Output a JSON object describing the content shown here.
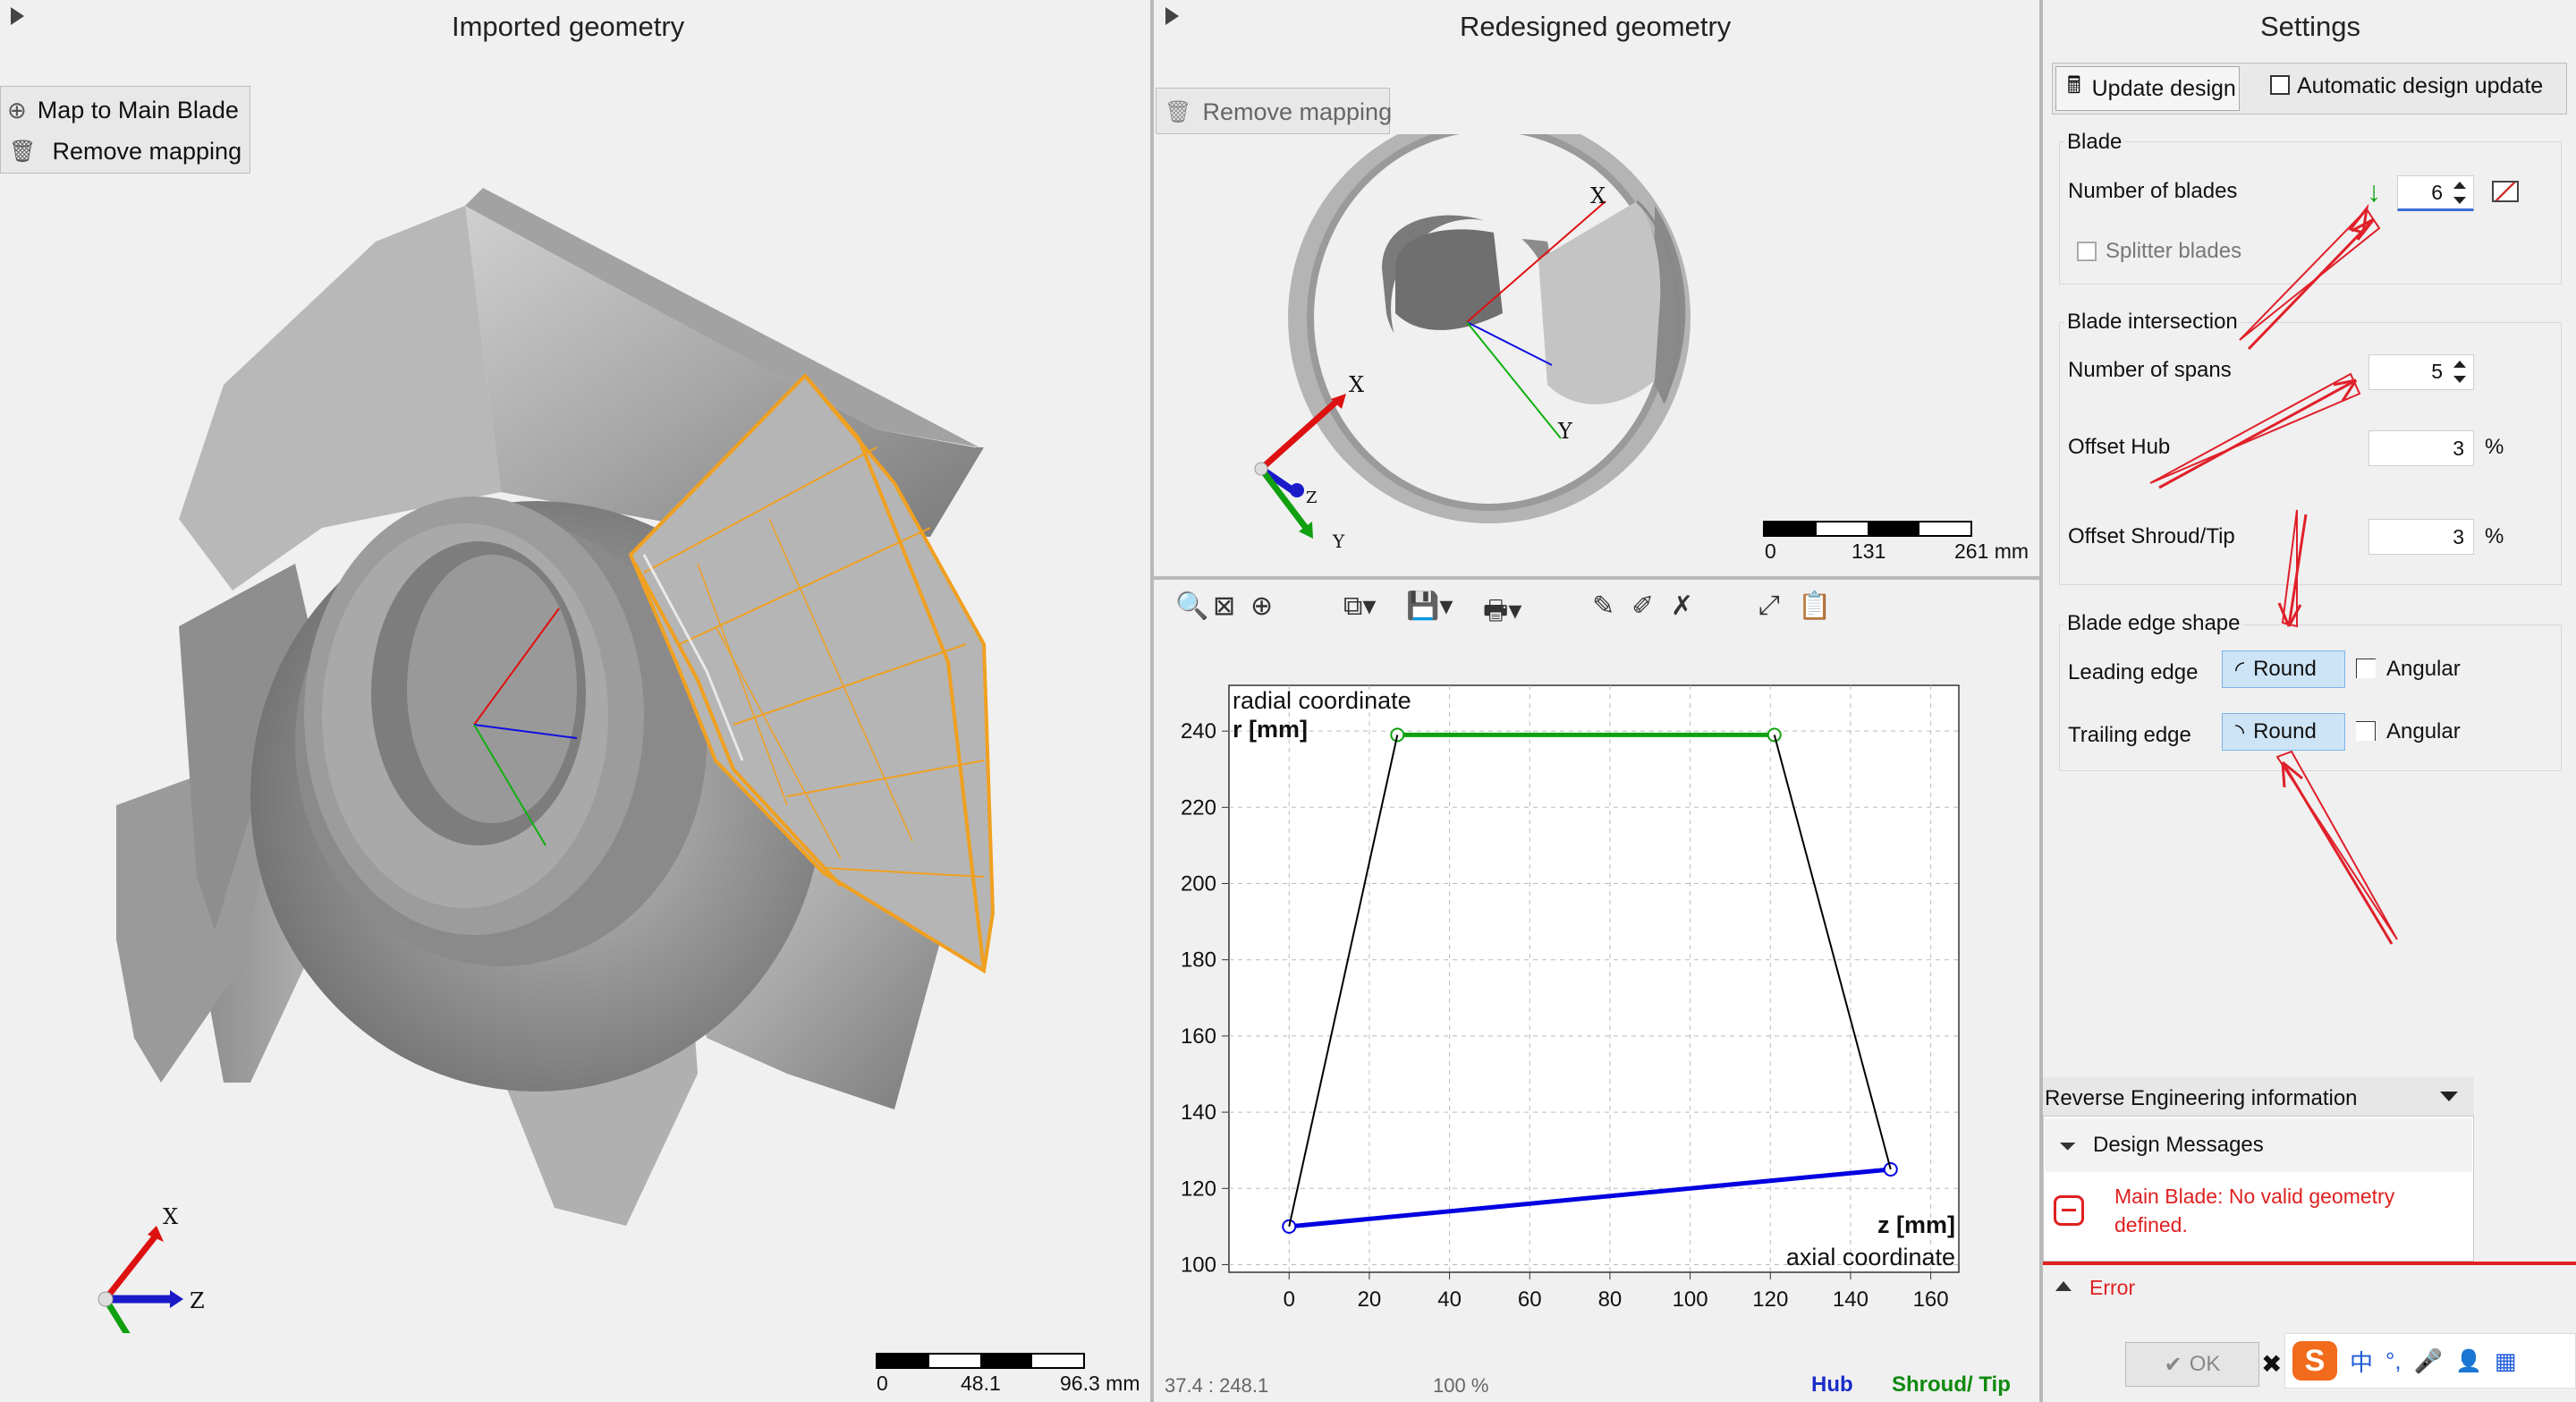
{
  "left_panel": {
    "title": "Imported geometry",
    "buttons": [
      {
        "label": "Map to Main Blade",
        "icon": "crosshair-icon"
      },
      {
        "label": "Remove mapping",
        "icon": "trash-icon"
      }
    ],
    "axes": {
      "x": "X",
      "y": "Y",
      "z": "Z"
    },
    "scale": {
      "ticks": [
        "0",
        "48.1",
        "96.3 mm"
      ]
    }
  },
  "mid_panel": {
    "title": "Redesigned geometry",
    "buttons": [
      {
        "label": "Remove mapping",
        "icon": "trash-icon"
      }
    ],
    "axes": {
      "x": "X",
      "y": "Y",
      "z": "Z"
    },
    "scale": {
      "ticks": [
        "0",
        "131",
        "261 mm"
      ]
    }
  },
  "chart_toolbar": {
    "icons": [
      "zoom-icon",
      "fit-icon",
      "crosshair-icon",
      "copy-icon",
      "save-icon",
      "print-icon",
      "edit-icon",
      "edit2-icon",
      "clear-icon",
      "expand-icon",
      "clipboard-icon"
    ]
  },
  "chart_data": {
    "type": "line",
    "title": "",
    "ylabel_top": "radial coordinate",
    "ylabel_unit": "r [mm]",
    "xlabel_unit": "z [mm]",
    "xlabel": "axial coordinate",
    "xlim": [
      -15,
      167
    ],
    "ylim": [
      98,
      252
    ],
    "xticks": [
      0,
      20,
      40,
      60,
      80,
      100,
      120,
      140,
      160
    ],
    "yticks": [
      100,
      120,
      140,
      160,
      180,
      200,
      220,
      240
    ],
    "grid": true,
    "series": [
      {
        "name": "Hub",
        "color": "#0000e0",
        "points": [
          [
            0,
            110
          ],
          [
            150,
            125
          ]
        ]
      },
      {
        "name": "Shroud/ Tip",
        "color": "#10a010",
        "points": [
          [
            27,
            239
          ],
          [
            121,
            239
          ]
        ]
      },
      {
        "name": "",
        "color": "#000000",
        "points": [
          [
            0,
            110
          ],
          [
            27,
            239
          ]
        ]
      },
      {
        "name": "",
        "color": "#000000",
        "points": [
          [
            150,
            125
          ],
          [
            121,
            239
          ]
        ]
      }
    ],
    "legend": [
      "Hub",
      "Shroud/ Tip"
    ],
    "legend_colors": [
      "#1a2dc8",
      "#0e8a0e"
    ]
  },
  "status": {
    "coords": "37.4 : 248.1",
    "zoom": "100 %"
  },
  "settings": {
    "title": "Settings",
    "update_button": "Update design",
    "auto_update_label": "Automatic design update",
    "blade": {
      "title": "Blade",
      "num_blades_label": "Number of blades",
      "num_blades_value": "6",
      "splitter_label": "Splitter blades"
    },
    "intersection": {
      "title": "Blade intersection",
      "spans_label": "Number of spans",
      "spans_value": "5",
      "offset_hub_label": "Offset Hub",
      "offset_hub_value": "3",
      "offset_shroud_label": "Offset Shroud/Tip",
      "offset_shroud_value": "3",
      "unit": "%"
    },
    "edge": {
      "title": "Blade edge shape",
      "leading_label": "Leading edge",
      "trailing_label": "Trailing edge",
      "round": "Round",
      "angular": "Angular"
    }
  },
  "info": {
    "title": "Reverse Engineering information",
    "messages_label": "Design Messages",
    "error_message_line1": "Main Blade: No valid geometry",
    "error_message_line2": "defined.",
    "error_label": "Error",
    "ok_label": "OK"
  },
  "colors": {
    "accent": "#cde4f7",
    "error": "#e02020",
    "hub": "#0000e0",
    "shroud": "#10a010",
    "highlight": "#f0a020"
  }
}
